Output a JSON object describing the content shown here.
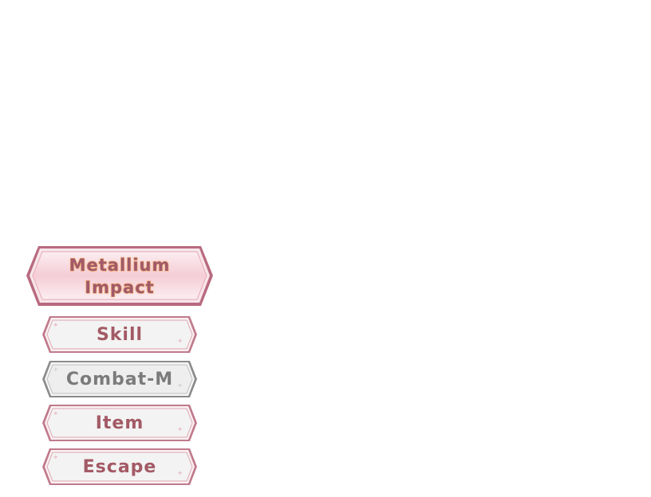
{
  "battle_menu": {
    "title_line1": "Metallium",
    "title_line2": "Impact",
    "buttons": [
      {
        "label": "Skill",
        "state": "active"
      },
      {
        "label": "Combat-M",
        "state": "disabled"
      },
      {
        "label": "Item",
        "state": "active"
      },
      {
        "label": "Escape",
        "state": "active"
      }
    ]
  },
  "colors": {
    "active_border": "#b86a80",
    "disabled_border": "#8c8c8c",
    "active_text": "#a35a65",
    "disabled_text": "#7b7b7b",
    "title_outline": "#f0a060"
  }
}
